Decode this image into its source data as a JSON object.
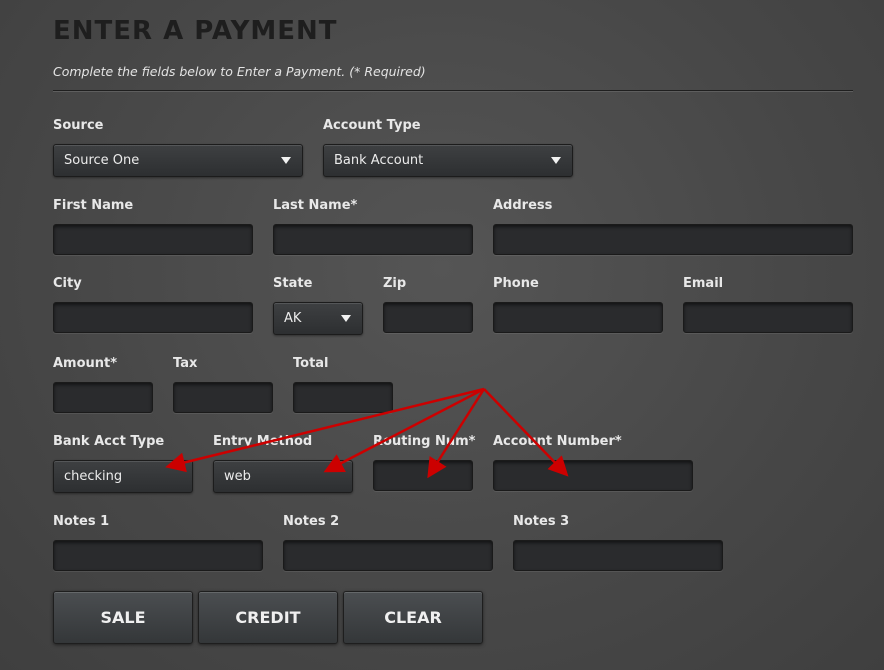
{
  "header": {
    "title": "ENTER A PAYMENT",
    "subtitle": "Complete the fields below to Enter a Payment. (* Required)"
  },
  "fields": {
    "source": {
      "label": "Source",
      "value": "Source One"
    },
    "account_type": {
      "label": "Account Type",
      "value": "Bank Account"
    },
    "first_name": {
      "label": "First Name",
      "value": ""
    },
    "last_name": {
      "label": "Last Name*",
      "value": ""
    },
    "address": {
      "label": "Address",
      "value": ""
    },
    "city": {
      "label": "City",
      "value": ""
    },
    "state": {
      "label": "State",
      "value": "AK"
    },
    "zip": {
      "label": "Zip",
      "value": ""
    },
    "phone": {
      "label": "Phone",
      "value": ""
    },
    "email": {
      "label": "Email",
      "value": ""
    },
    "amount": {
      "label": "Amount*",
      "value": ""
    },
    "tax": {
      "label": "Tax",
      "value": ""
    },
    "total": {
      "label": "Total",
      "value": ""
    },
    "bank_acct_type": {
      "label": "Bank Acct Type",
      "value": "checking"
    },
    "entry_method": {
      "label": "Entry Method",
      "value": "web"
    },
    "routing_num": {
      "label": "Routing Num*",
      "value": ""
    },
    "account_number": {
      "label": "Account Number*",
      "value": ""
    },
    "notes1": {
      "label": "Notes 1",
      "value": ""
    },
    "notes2": {
      "label": "Notes 2",
      "value": ""
    },
    "notes3": {
      "label": "Notes 3",
      "value": ""
    }
  },
  "buttons": {
    "sale": "SALE",
    "credit": "CREDIT",
    "clear": "CLEAR"
  },
  "colors": {
    "background": "#4a4a4a",
    "input_bg": "#2a2b2d",
    "annotation_arrow": "#cc0000"
  },
  "icons": [
    "dropdown-caret-icon",
    "annotation-arrow"
  ]
}
